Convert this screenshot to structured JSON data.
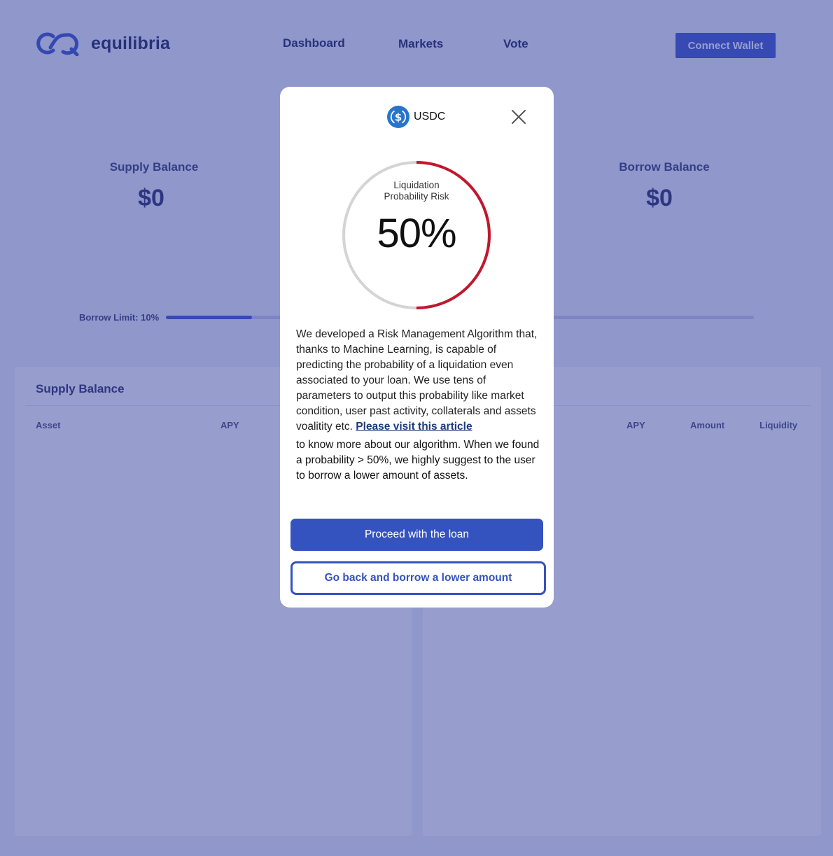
{
  "brand": {
    "name": "equilibria"
  },
  "nav": {
    "items": [
      {
        "label": "Dashboard"
      },
      {
        "label": "Markets"
      },
      {
        "label": "Vote"
      }
    ],
    "connect_label": "Connect Wallet"
  },
  "summary": {
    "supply_label": "Supply Balance",
    "supply_value": "$0",
    "borrow_label": "Borrow Balance",
    "borrow_value": "$0",
    "borrow_limit_label": "Borrow Limit: 10%",
    "borrow_limit_fraction": 0.147
  },
  "supply_panel": {
    "title": "Supply Balance",
    "columns": [
      "Asset",
      "APY"
    ]
  },
  "borrow_panel": {
    "columns": [
      "APY",
      "Amount",
      "Liquidity"
    ]
  },
  "modal": {
    "asset": "USDC",
    "asset_icon": "usdc-coin-icon",
    "close_icon": "close-icon",
    "gauge_caption_line1": "Liquidation",
    "gauge_caption_line2": "Probability Risk",
    "gauge_value": "50%",
    "gauge_fraction": 0.5,
    "description": "We developed a Risk Management Algorithm that, thanks to Machine Learning, is capable of predicting the probability of a liquidation even associated to your loan. We use tens of parameters to output this probability like market condition, user past activity, collaterals and assets voalitity etc.",
    "link_text": "Please visit this article",
    "description_after": "to know more about our algorithm. When we found a probability > 50%, we highly suggest to the user to borrow a lower amount of assets.",
    "proceed_label": "Proceed with the loan",
    "back_label": "Go back and borrow a lower amount"
  },
  "colors": {
    "overlay": "#303e9e",
    "primary": "#3553bf",
    "risk": "#c0182e",
    "gauge_track": "#d4d4d4"
  }
}
